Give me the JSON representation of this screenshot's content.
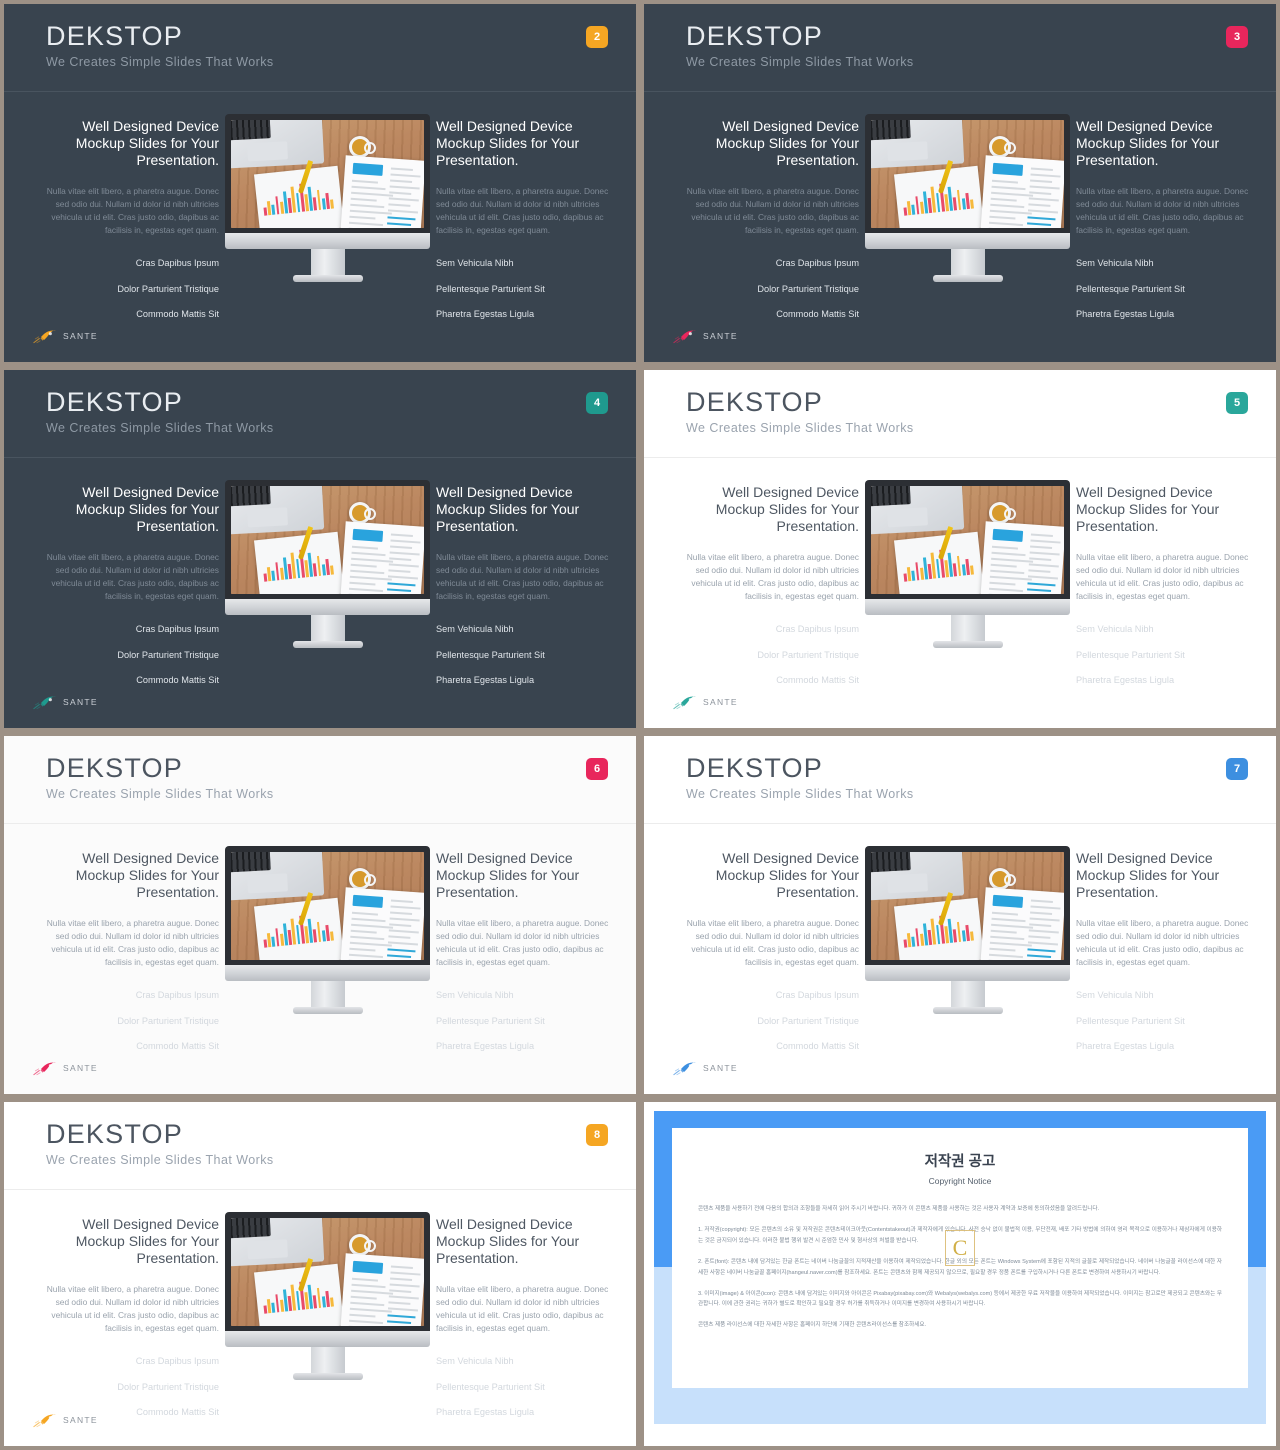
{
  "deck": {
    "common": {
      "title": "DEKSTOP",
      "subtitle": "We Creates Simple Slides That Works",
      "logo_text": "SANTE",
      "left_heading": "Well Designed Device Mockup Slides for Your Presentation.",
      "right_heading": "Well Designed Device Mockup Slides for Your Presentation.",
      "left_body": "Nulla vitae elit libero, a pharetra augue. Donec sed odio dui. Nullam id dolor id nibh ultricies vehicula ut id elit. Cras justo odio, dapibus ac facilisis in, egestas eget quam.",
      "right_body": "Nulla vitae elit libero, a pharetra augue. Donec sed odio dui. Nullam id dolor id nibh ultricies vehicula ut id elit. Cras justo odio, dapibus ac facilisis in, egestas eget quam.",
      "left_items": [
        "Cras Dapibus Ipsum",
        "Dolor Parturient Tristique",
        "Commodo Mattis Sit"
      ],
      "right_items": [
        "Sem Vehicula Nibh",
        "Pellentesque Parturient Sit",
        "Pharetra Egestas Ligula"
      ]
    },
    "slides": [
      {
        "number": "2",
        "theme": "dark",
        "accent": "#f5a623"
      },
      {
        "number": "3",
        "theme": "dark",
        "accent": "#e8265c"
      },
      {
        "number": "4",
        "theme": "dark",
        "accent": "#1f9a8e"
      },
      {
        "number": "5",
        "theme": "light",
        "accent": "#2aa79b"
      },
      {
        "number": "6",
        "theme": "lightgray",
        "accent": "#e8265c"
      },
      {
        "number": "7",
        "theme": "light",
        "accent": "#3d8fe0"
      },
      {
        "number": "8",
        "theme": "light",
        "accent": "#f5a623"
      }
    ]
  },
  "copyright": {
    "title": "저작권 공고",
    "subtitle": "Copyright Notice",
    "watermark": "C",
    "paragraphs": [
      "콘텐츠 제품을 사용하기 전에 다음의 합의과 조항들을 자세히 읽어 주시기 바랍니다. 귀하가 이 콘텐츠 제품을 사용하는 것은 사용자 계약과 보증에 동의하셨음을 알려드립니다.",
      "1. 저작권(copyright): 모든 콘텐츠의 소유 및 저작권은 콘텐츠테이크아웃(Contentstakeout)과 제작자에게 있습니다. 사전 승낙 없이 불법적 이용, 무단전재, 배포 기타 방법에 의하여 영리 목적으로 이용하거나 제삼자에게 이용하는 것은 금지되어 있습니다. 이러한 불법 행위 발견 시 준엄한 민사 및 형사상의 처벌을 받습니다.",
      "2. 폰트(font): 콘텐츠 내에 담겨있는 한글 폰트는 네이버 나눔글꼴의 지적재산을 이용하여 제작되었습니다. 한글 외의 모든 폰트는 Windows System에 포함된 지적의 글꼴로 제작되었습니다. 네이버 나눔글꼴 라이선스에 대한 자세한 사항은 네이버 나눔글꼴 홈페이지(hangeul.naver.com)를 참조하세요. 폰트는 콘텐츠와 함께 제공되지 않으므로, 필요할 경우 정품 폰트를 구입하시거나 다른 폰트로 변경하여 사용하시기 바랍니다.",
      "3. 이미지(image) & 아이콘(icon): 콘텐츠 내에 담겨있는 이미지와 아이콘은 Pixabay(pixabay.com)와 Webalys(webalys.com) 등에서 제공한 무료 저작물을 이용하여 제작되었습니다. 이미지는 참고로만 제공되고 콘텐츠와는 무관합니다. 이에 관한 권리는 귀하가 별도로 확인하고 필요할 경우 허가를 취득하거나 이미지를 변경하여 사용하시기 바랍니다.",
      "콘텐츠 제품 라이선스에 대한 자세한 사항은 홈페이지 하단에 기재한 콘텐츠라이선스를 참조하세요."
    ]
  }
}
